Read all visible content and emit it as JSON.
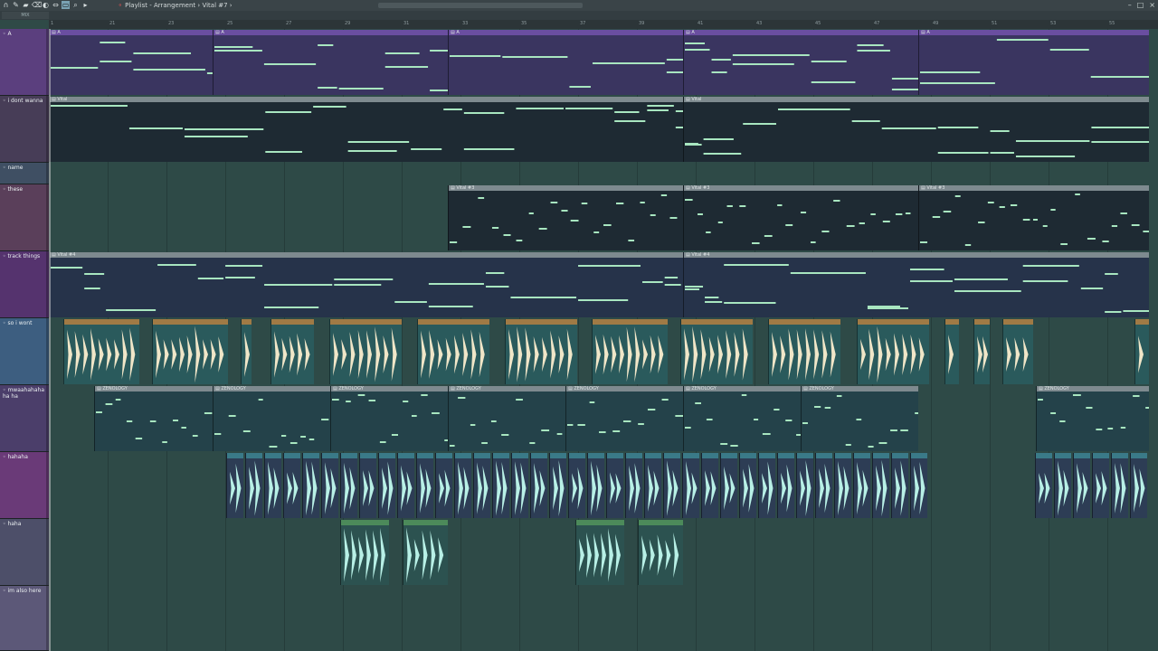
{
  "window": {
    "title": "Playlist - Arrangement",
    "pattern": "Vital #7",
    "separator": "›",
    "dot": "⚬"
  },
  "toolbar": {
    "snap_label": "MIX",
    "tools": [
      "magnet-icon",
      "draw-icon",
      "paint-icon",
      "delete-icon",
      "mute-icon",
      "slip-icon",
      "select-icon",
      "zoom-icon",
      "play-icon"
    ],
    "active_tool": "select-icon"
  },
  "window_buttons": [
    "–",
    "□",
    "×"
  ],
  "ruler": {
    "bars": [
      "1",
      "21",
      "23",
      "25",
      "27",
      "29",
      "31",
      "33",
      "35",
      "37",
      "39",
      "41",
      "43",
      "45",
      "47",
      "49",
      "51",
      "53",
      "55"
    ]
  },
  "tracks": [
    {
      "name": "A",
      "color": "#5b3f7e"
    },
    {
      "name": "i dont wanna",
      "color": "#473d57"
    },
    {
      "name": "name",
      "color": "#3f4f63"
    },
    {
      "name": "these",
      "color": "#5a3f5a"
    },
    {
      "name": "track things",
      "color": "#55336e"
    },
    {
      "name": "so i wont",
      "color": "#3d5e80"
    },
    {
      "name": "mwaahahahaha ha",
      "color": "#4b3e6a"
    },
    {
      "name": "hahaha",
      "color": "#6a3a78"
    },
    {
      "name": "haha",
      "color": "#4d4f69"
    },
    {
      "name": "im also here",
      "color": "#5c5878"
    }
  ],
  "clips": {
    "A": [
      "A",
      "A",
      "A",
      "A",
      "A"
    ],
    "i_dont_wanna": [
      "Vital",
      "Vital"
    ],
    "these": [
      "Vital #3",
      "Vital #3",
      "Vital #3"
    ],
    "track_things": [
      "Vital #4",
      "Vital #4"
    ],
    "mwaahahahaha": [
      "ZENOLOGY",
      "ZENOLOGY",
      "ZENOLOGY",
      "ZENOLOGY",
      "ZENOLOGY",
      "ZENOLOGY",
      "ZENOLOGY",
      "ZENOLOGY"
    ]
  },
  "colors": {
    "midi_purple": "#3a3560",
    "midi_header_purple": "#6a4ea0",
    "midi_dark": "#1e2a33",
    "midi_header_gray": "#7e8a8f",
    "note_green": "#a8e6c0",
    "audio_bg": "#2a5a5c",
    "audio_header_orange": "#a07a45",
    "audio_header_green": "#4c8a5a",
    "wave_light": "#f0e6c8",
    "wave_cyan": "#b8f0e6"
  }
}
